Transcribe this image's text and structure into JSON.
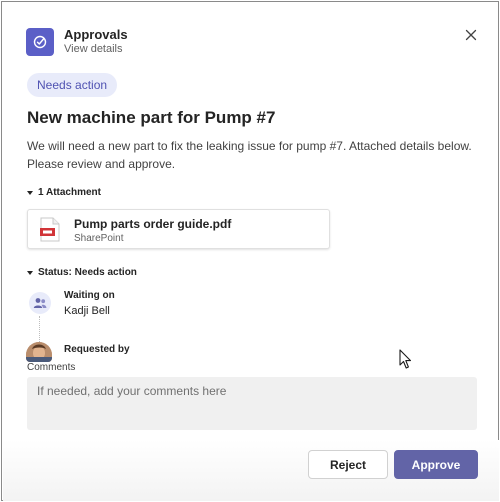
{
  "header": {
    "title": "Approvals",
    "subtitle": "View details",
    "app_icon": "approvals-check-icon",
    "close_icon": "close-icon"
  },
  "badge": "Needs action",
  "request": {
    "title": "New machine part for Pump #7",
    "description": "We will need a new part to fix the leaking issue for pump #7. Attached details below. Please review and approve."
  },
  "attachments": {
    "header": "1 Attachment",
    "items": [
      {
        "name": "Pump parts order guide.pdf",
        "source": "SharePoint",
        "icon": "pdf-file-icon"
      }
    ]
  },
  "status": {
    "header": "Status: Needs action",
    "waiting_label": "Waiting on",
    "waiting_name": "Kadji Bell",
    "requested_label": "Requested by"
  },
  "comments": {
    "label": "Comments",
    "placeholder": "If needed, add your comments here"
  },
  "actions": {
    "reject": "Reject",
    "approve": "Approve"
  },
  "colors": {
    "accent": "#5b5fc7",
    "approve_button": "#6264a7",
    "badge_bg": "#e8ebfa",
    "badge_text": "#4f52b2"
  }
}
